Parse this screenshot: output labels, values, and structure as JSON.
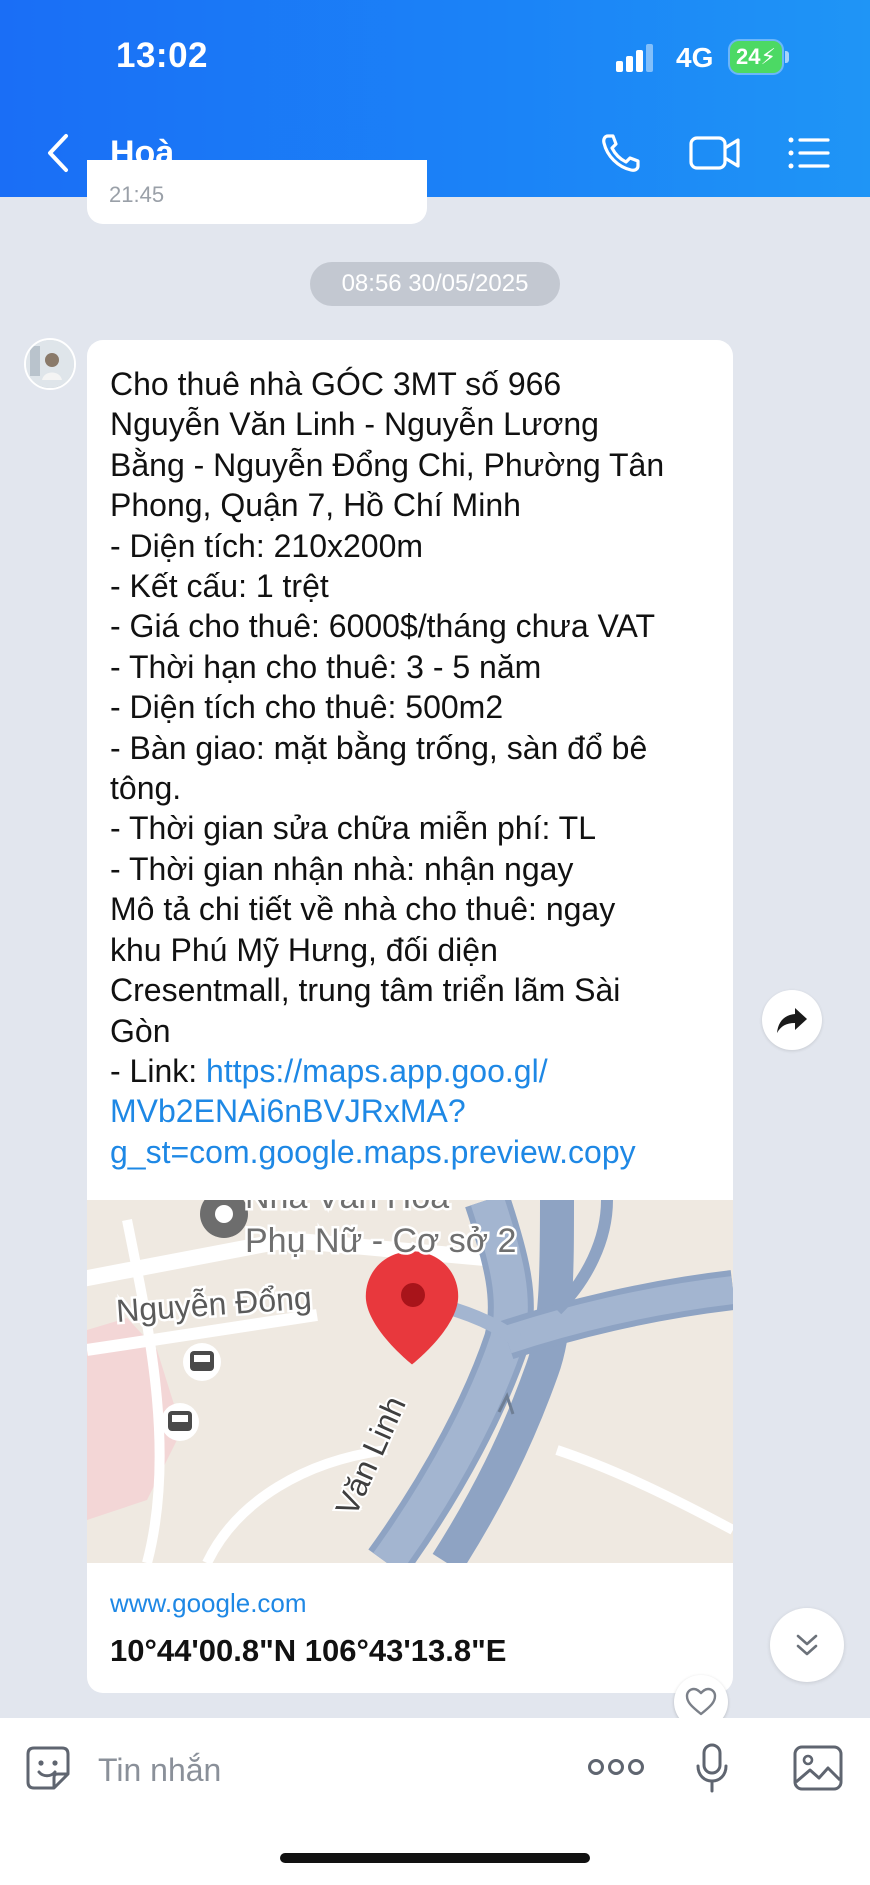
{
  "status_bar": {
    "time": "13:02",
    "network": "4G",
    "battery": "24"
  },
  "header": {
    "title": "Hoà"
  },
  "previous_message": {
    "time": "21:45"
  },
  "date_separator": "08:56 30/05/2025",
  "message": {
    "lines": [
      "Cho thuê nhà GÓC 3MT số 966",
      "Nguyễn Văn Linh - Nguyễn Lương",
      "Bằng - Nguyễn Đổng Chi, Phường Tân",
      "Phong, Quận 7, Hồ Chí Minh",
      "- Diện tích: 210x200m",
      "- Kết cấu: 1 trệt",
      "- Giá cho thuê: 6000$/tháng chưa VAT",
      "- Thời hạn cho thuê: 3 - 5 năm",
      "- Diện tích cho thuê: 500m2",
      "- Bàn giao: mặt bằng trống, sàn đổ bê",
      "tông.",
      "- Thời gian sửa chữa miễn phí: TL",
      "- Thời gian nhận nhà: nhận ngay",
      "Mô tả chi tiết về nhà cho thuê: ngay",
      "khu Phú Mỹ Hưng, đối diện",
      "Cresentmall, trung tâm triển lãm Sài",
      "Gòn"
    ],
    "link_prefix": "- Link: ",
    "link_lines": [
      "https://maps.app.goo.gl/",
      "MVb2ENAi6nBVJRxMA?",
      "g_st=com.google.maps.preview.copy"
    ]
  },
  "map": {
    "labels": {
      "place_line1": "Nhà Văn Hoá",
      "place_line2": "Phụ Nữ - Cơ sở 2",
      "street_left": "Nguyễn Đổng",
      "street_diag": "Văn Linh"
    }
  },
  "link_preview": {
    "domain": "www.google.com",
    "title": "10°44'00.8\"N 106°43'13.8\"E"
  },
  "input": {
    "placeholder": "Tin nhắn"
  },
  "colors": {
    "header_blue": "#1b7ef7",
    "chat_background": "#e2e6ee",
    "link": "#1e88e5",
    "map_pin": "#e8383d",
    "battery": "#4cd964"
  },
  "icons": [
    "signal-icon",
    "back-icon",
    "phone-icon",
    "video-call-icon",
    "menu-list-icon",
    "share-icon",
    "chevron-double-down-icon",
    "heart-icon",
    "sticker-icon",
    "more-options-icon",
    "microphone-icon",
    "image-icon"
  ]
}
